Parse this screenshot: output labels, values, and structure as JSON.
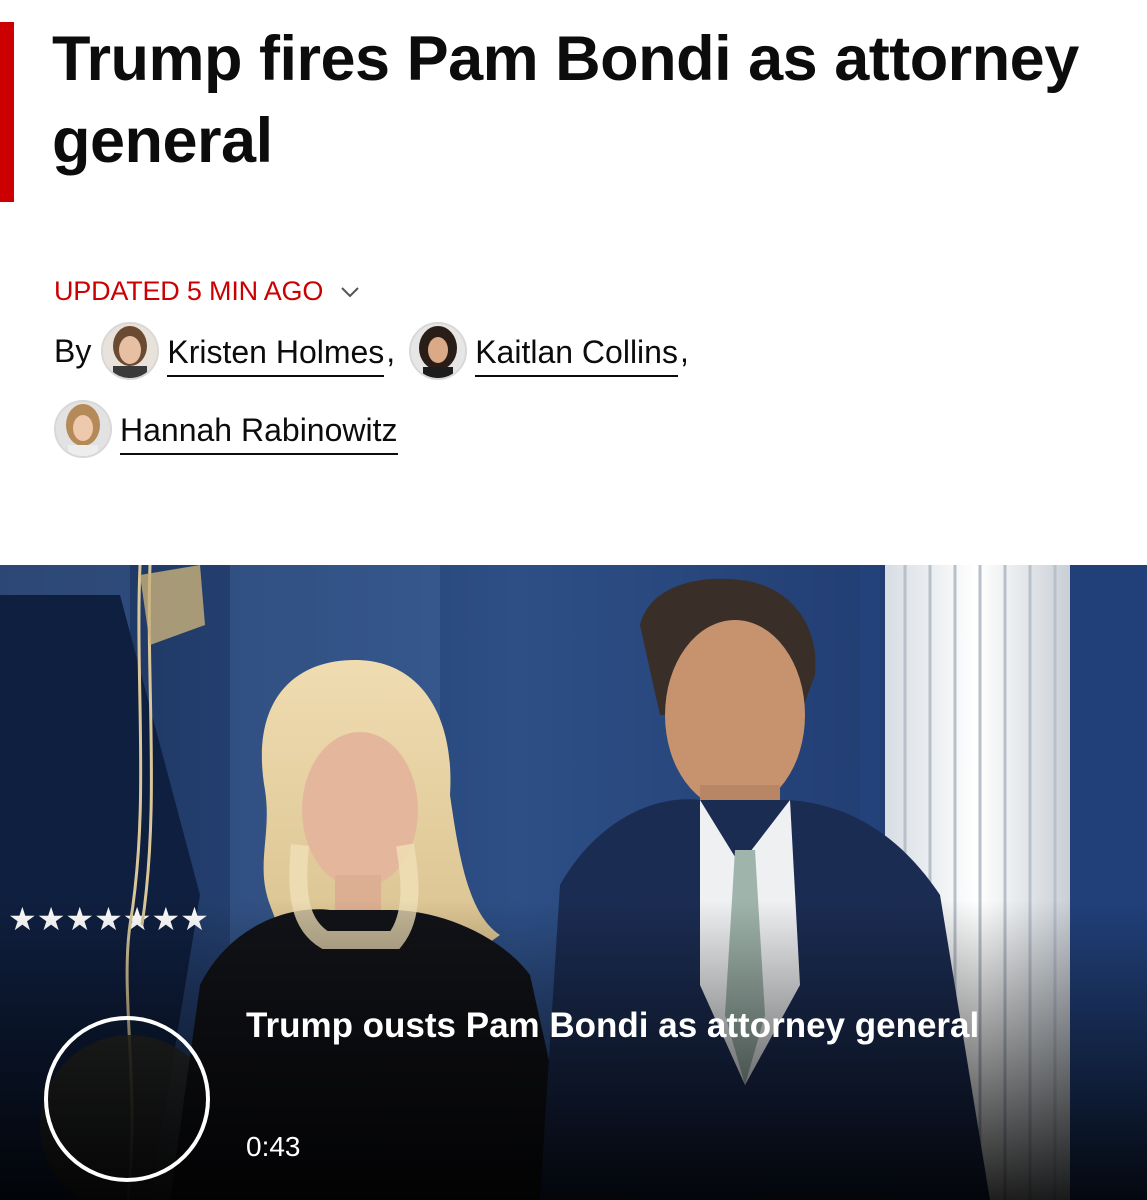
{
  "article": {
    "headline": "Trump fires Pam Bondi as attorney general",
    "updated": "UPDATED 5 MIN AGO",
    "byline": {
      "by_label": "By",
      "authors": [
        {
          "name": "Kristen Holmes"
        },
        {
          "name": "Kaitlan Collins"
        },
        {
          "name": "Hannah Rabinowitz"
        }
      ],
      "separator": ","
    }
  },
  "video": {
    "title": "Trump ousts Pam Bondi as attorney general",
    "duration": "0:43",
    "play_icon": "circle-play-icon"
  },
  "colors": {
    "accent": "#cc0000",
    "text": "#0c0c0c",
    "background": "#ffffff"
  }
}
